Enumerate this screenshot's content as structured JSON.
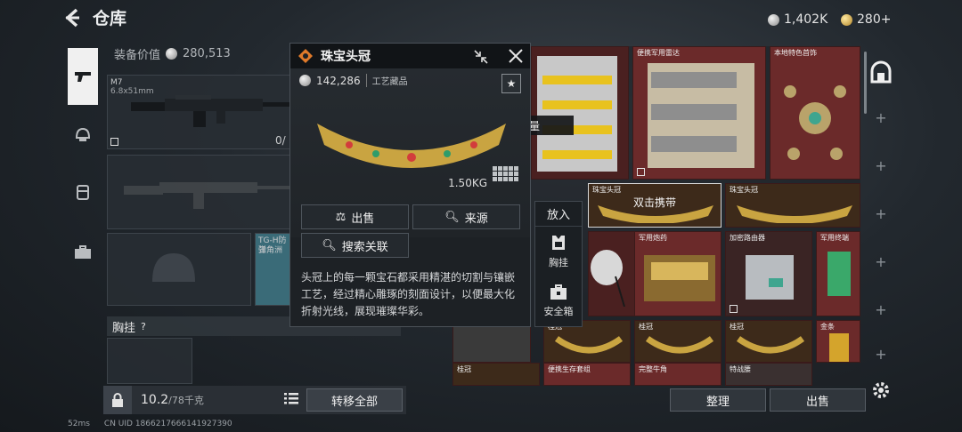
{
  "header": {
    "back_icon": "chevron-left-icon",
    "title": "仓库",
    "currency_silver": "1,402K",
    "currency_gold": "280+"
  },
  "equipment": {
    "value_label": "装备价值",
    "value": "280,513",
    "weapon_name": "M7",
    "weapon_ammo": "6.8x51mm",
    "weapon_count": "0/",
    "armor_name": "TG-H防弹",
    "armor_sub": "三角洲",
    "chest_label": "胸挂",
    "chest_help": "?"
  },
  "capacity": {
    "current": "10.2",
    "max": "/78千克"
  },
  "buttons": {
    "transfer_all": "转移全部",
    "sort": "整理",
    "sell": "出售"
  },
  "popup": {
    "title": "珠宝头冠",
    "value": "142,286",
    "category": "工艺藏品",
    "weight": "1.50KG",
    "sell": "出售",
    "source": "来源",
    "search_related": "搜索关联",
    "description": "头冠上的每一颗宝石都采用精湛的切割与镶嵌工艺，经过精心雕琢的刻面设计，以便最大化折射光线，展现璀璨华彩。"
  },
  "toast": "携带空间不足，需要容量",
  "put_in": {
    "title": "放入",
    "chest": "胸挂",
    "safe": "安全箱"
  },
  "storage": {
    "cells": [
      {
        "label": "便携军用雷达"
      },
      {
        "label": "本地特色首饰"
      },
      {
        "label": "珠宝头冠",
        "overlay": "双击携带"
      },
      {
        "label": "珠宝头冠"
      },
      {
        "label": "军用炮药"
      },
      {
        "label": "加密路由器"
      },
      {
        "label": "军用终端"
      },
      {
        "label": "桂冠"
      },
      {
        "label": "桂冠"
      },
      {
        "label": "金条"
      },
      {
        "label": "桂冠"
      },
      {
        "label": "便携生存套组"
      },
      {
        "label": "完整牛角"
      },
      {
        "label": "特战腰"
      }
    ]
  },
  "footer": {
    "ping": "52ms",
    "uid": "CN UID 1866217666141927390"
  },
  "colors": {
    "rare_cell": "#6b2a2a",
    "accent_orange": "#e07a2a",
    "panel": "#1d2125"
  }
}
